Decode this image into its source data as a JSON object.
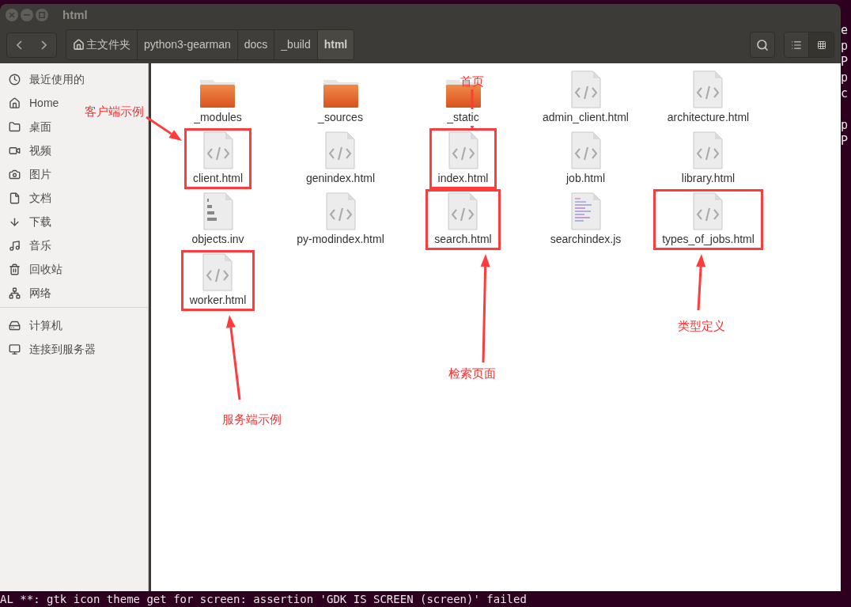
{
  "terminal": {
    "right_edge": [
      "e",
      "p",
      "P",
      "p",
      "c",
      "p",
      "P"
    ],
    "bottom_line": "AL **: gtk icon theme get for screen: assertion 'GDK IS SCREEN (screen)' failed"
  },
  "window": {
    "title": "html"
  },
  "toolbar": {
    "breadcrumbs": [
      {
        "label": "主文件夹",
        "kind": "home",
        "selected": false
      },
      {
        "label": "python3-gearman",
        "kind": "folder",
        "selected": false
      },
      {
        "label": "docs",
        "kind": "folder",
        "selected": false
      },
      {
        "label": "_build",
        "kind": "folder",
        "selected": false
      },
      {
        "label": "html",
        "kind": "folder",
        "selected": true
      }
    ],
    "views": [
      {
        "kind": "list",
        "selected": false
      },
      {
        "kind": "grid",
        "selected": true
      }
    ]
  },
  "sidebar": {
    "groups": [
      [
        {
          "label": "最近使用的",
          "kind": "recent"
        },
        {
          "label": "Home",
          "kind": "home"
        },
        {
          "label": "桌面",
          "kind": "desktop"
        },
        {
          "label": "视频",
          "kind": "videos"
        },
        {
          "label": "图片",
          "kind": "pictures"
        },
        {
          "label": "文档",
          "kind": "documents"
        },
        {
          "label": "下载",
          "kind": "downloads"
        },
        {
          "label": "音乐",
          "kind": "music"
        },
        {
          "label": "回收站",
          "kind": "trash"
        },
        {
          "label": "网络",
          "kind": "network"
        }
      ],
      [
        {
          "label": "计算机",
          "kind": "computer"
        },
        {
          "label": "连接到服务器",
          "kind": "server"
        }
      ]
    ]
  },
  "files": [
    {
      "name": "_modules",
      "kind": "folder",
      "highlighted": false
    },
    {
      "name": "_sources",
      "kind": "folder",
      "highlighted": false
    },
    {
      "name": "_static",
      "kind": "folder",
      "highlighted": false
    },
    {
      "name": "admin_client.html",
      "kind": "html",
      "highlighted": false
    },
    {
      "name": "architecture.html",
      "kind": "html",
      "highlighted": false
    },
    {
      "name": "client.html",
      "kind": "html",
      "highlighted": true
    },
    {
      "name": "genindex.html",
      "kind": "html",
      "highlighted": false
    },
    {
      "name": "index.html",
      "kind": "html",
      "highlighted": true
    },
    {
      "name": "job.html",
      "kind": "html",
      "highlighted": false
    },
    {
      "name": "library.html",
      "kind": "html",
      "highlighted": false
    },
    {
      "name": "objects.inv",
      "kind": "binary",
      "highlighted": false
    },
    {
      "name": "py-modindex.html",
      "kind": "html",
      "highlighted": false
    },
    {
      "name": "search.html",
      "kind": "html",
      "highlighted": true
    },
    {
      "name": "searchindex.js",
      "kind": "script",
      "highlighted": false
    },
    {
      "name": "types_of_jobs.html",
      "kind": "html",
      "highlighted": true
    },
    {
      "name": "worker.html",
      "kind": "html",
      "highlighted": true
    }
  ],
  "annotations": [
    {
      "text": "客户端示例"
    },
    {
      "text": "首页"
    },
    {
      "text": "检索页面"
    },
    {
      "text": "类型定义"
    },
    {
      "text": "服务端示例"
    }
  ]
}
